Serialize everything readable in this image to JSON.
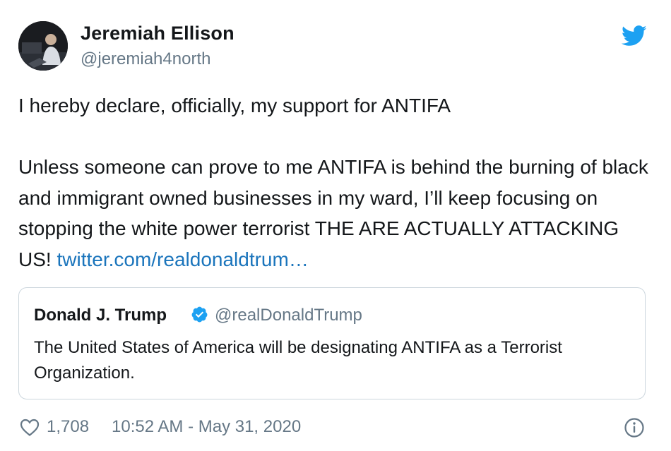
{
  "author": {
    "display_name": "Jeremiah Ellison",
    "handle": "@jeremiah4north",
    "avatar_icon": "avatar-photo"
  },
  "brand": {
    "icon": "twitter-bird-icon",
    "color": "#1da1f2"
  },
  "tweet": {
    "line1": "I hereby declare, officially, my support for ANTIFA",
    "body_text": "Unless someone can prove to me ANTIFA is behind the burning of black and immigrant owned businesses in my ward, I’ll keep focusing on stopping the white power terrorist THE ARE ACTUALLY ATTACKING US! ",
    "link_text": "twitter.com/realdonaldtrum…",
    "link_color": "#1b75bc"
  },
  "quoted_tweet": {
    "display_name": "Donald J. Trump",
    "verified": true,
    "handle": "@realDonaldTrump",
    "text": "The United States of America will be designating ANTIFA as a Terrorist Organization."
  },
  "footer": {
    "like_count": "1,708",
    "timestamp": "10:52 AM - May 31, 2020",
    "heart_icon": "heart-icon",
    "info_icon": "info-icon"
  },
  "colors": {
    "text_primary": "#14171a",
    "text_secondary": "#657786",
    "border": "#ccd6dd"
  }
}
